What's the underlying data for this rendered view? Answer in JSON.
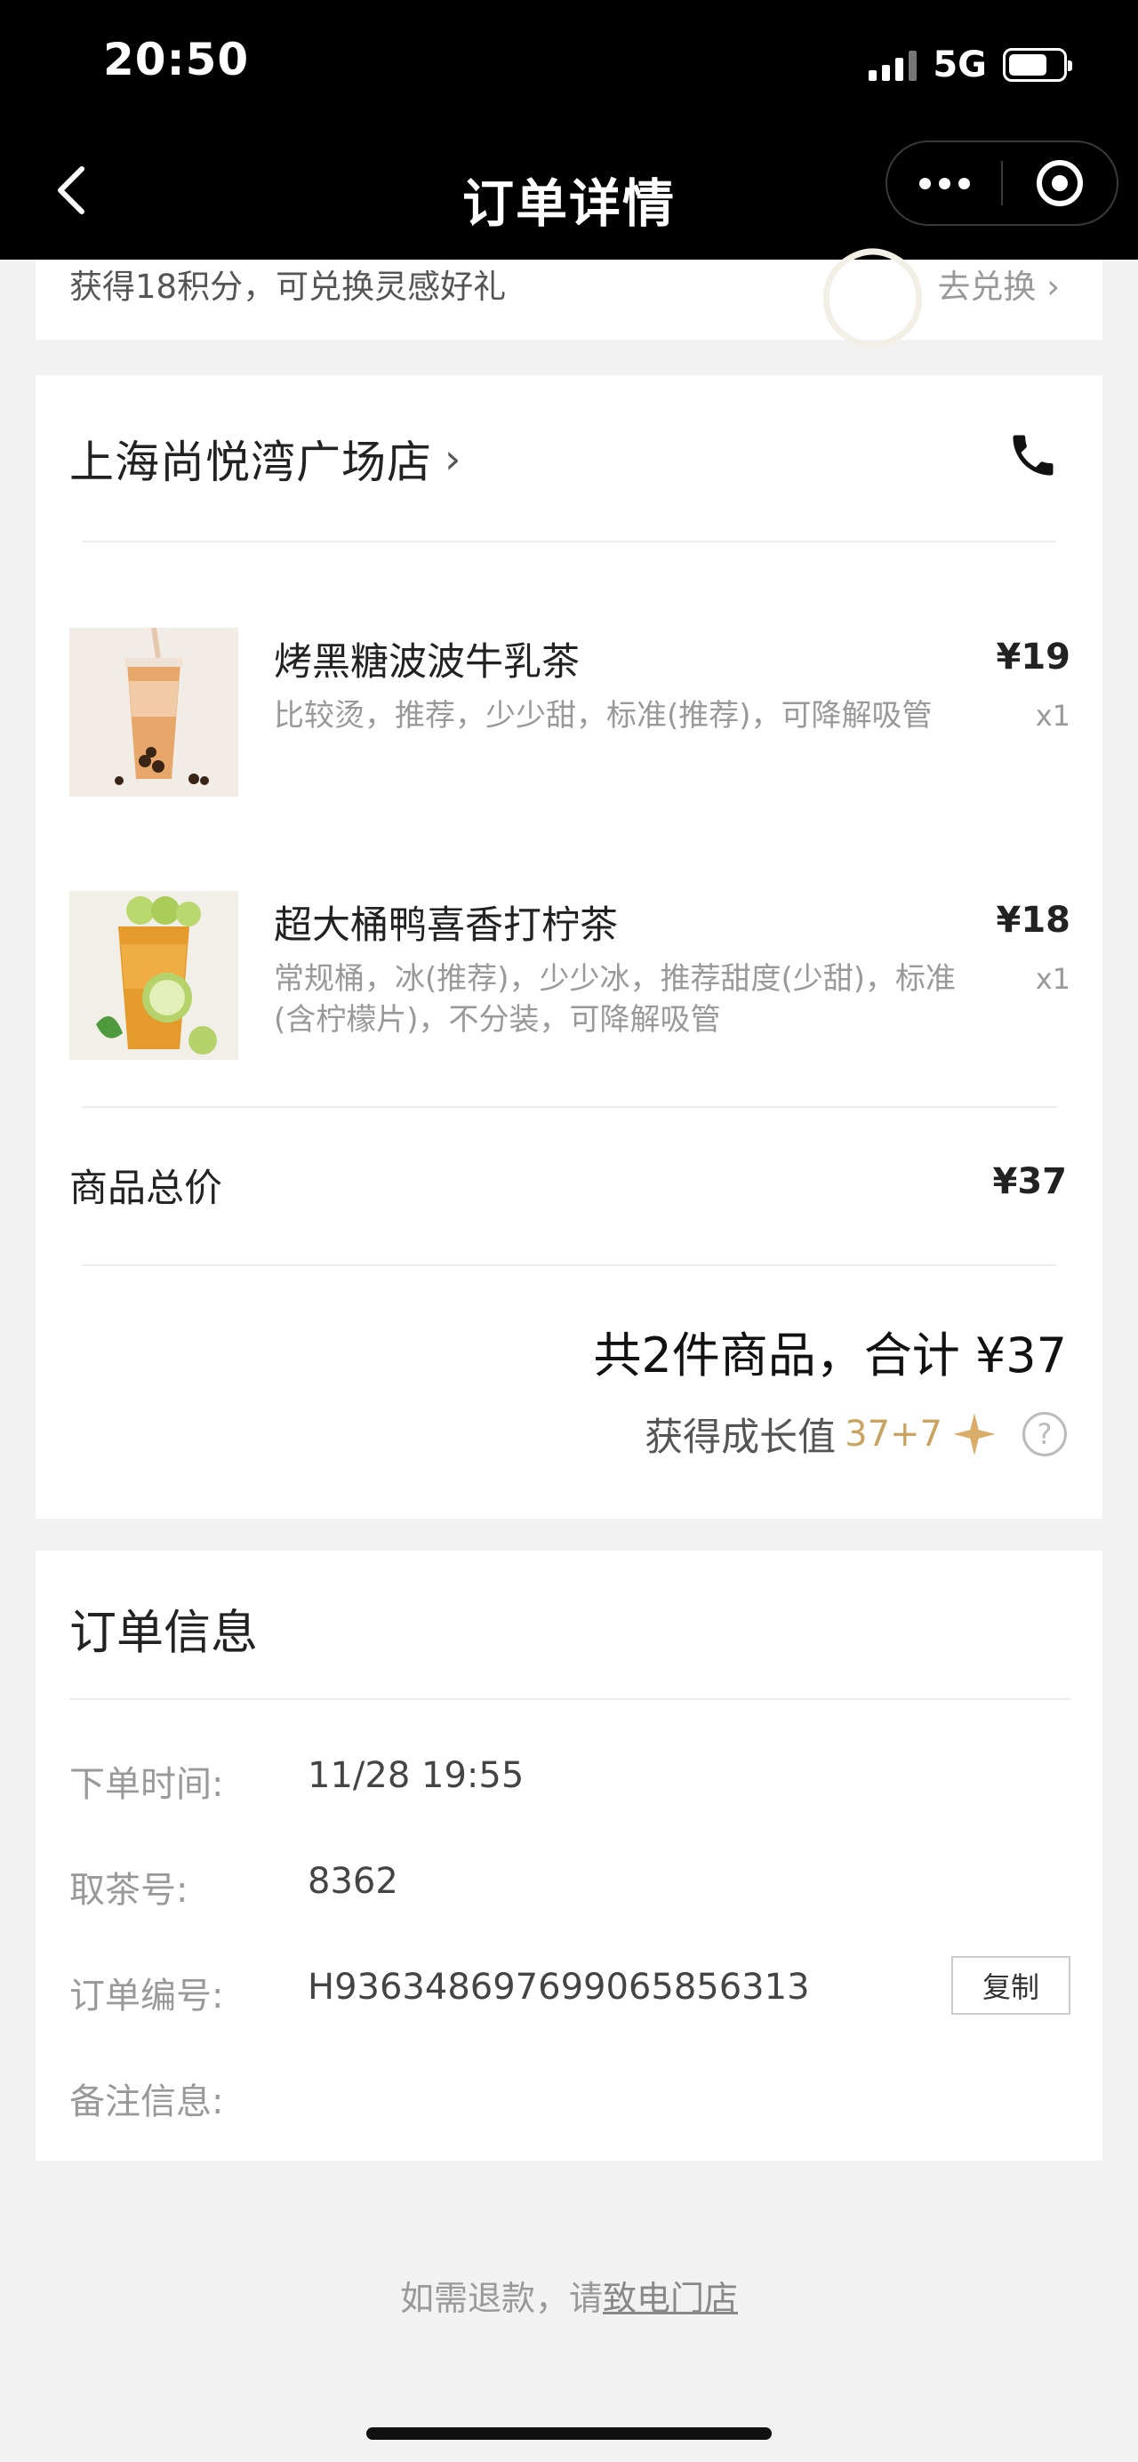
{
  "status_bar": {
    "time": "20:50",
    "network": "5G"
  },
  "nav": {
    "title": "订单详情"
  },
  "points": {
    "text": "获得18积分，可兑换灵感好礼",
    "link": "去兑换 ›"
  },
  "store": {
    "name": "上海尚悦湾广场店",
    "chevron": "›"
  },
  "items": [
    {
      "name": "烤黑糖波波牛乳茶",
      "spec": "比较烫，推荐，少少甜，标准(推荐)，可降解吸管",
      "price": "¥19",
      "qty": "x1"
    },
    {
      "name": "超大桶鸭喜香打柠茶",
      "spec": "常规桶，冰(推荐)，少少冰，推荐甜度(少甜)，标准(含柠檬片)，不分装，可降解吸管",
      "price": "¥18",
      "qty": "x1"
    }
  ],
  "summary": {
    "subtotal_label": "商品总价",
    "subtotal_value": "¥37",
    "total_text": "共2件商品，合计 ¥37",
    "growth_label": "获得成长值",
    "growth_value": "37+7",
    "help": "?"
  },
  "order_info": {
    "title": "订单信息",
    "rows": [
      {
        "label": "下单时间:",
        "value": "11/28 19:55"
      },
      {
        "label": "取茶号:",
        "value": "8362"
      },
      {
        "label": "订单编号:",
        "value": "H936348697699065856313"
      },
      {
        "label": "备注信息:",
        "value": ""
      }
    ],
    "copy_label": "复制"
  },
  "footer": {
    "refund_prefix": "如需退款，请",
    "refund_link": "致电门店"
  },
  "colors": {
    "accent_gold": "#c9a35f",
    "header_bg": "#000000",
    "page_bg": "#f3f2f2"
  }
}
